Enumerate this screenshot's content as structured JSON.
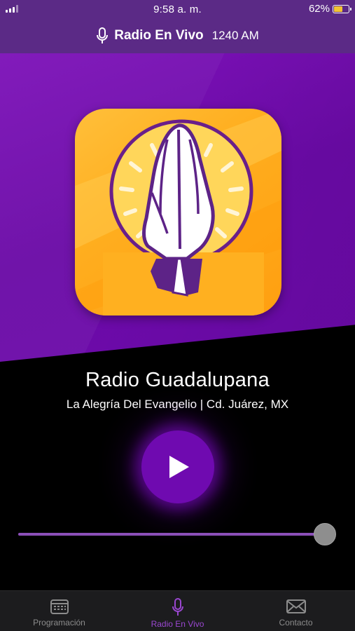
{
  "status_bar": {
    "time": "9:58 a. m.",
    "battery": "62%",
    "battery_level": 0.62
  },
  "header": {
    "title": "Radio En Vivo",
    "frequency": "1240 AM",
    "icon": "microphone-icon"
  },
  "station": {
    "name": "Radio Guadalupana",
    "tagline": "La Alegría Del Evangelio | Cd. Juárez, MX",
    "logo_icon": "praying-hands-icon"
  },
  "player": {
    "play_icon": "play-icon",
    "volume_level": 0.99
  },
  "tabs": [
    {
      "label": "Programación",
      "icon": "calendar-icon",
      "active": false
    },
    {
      "label": "Radio En Vivo",
      "icon": "microphone-icon",
      "active": true
    },
    {
      "label": "Contacto",
      "icon": "envelope-icon",
      "active": false
    }
  ],
  "colors": {
    "header_purple": "#5b2a86",
    "hero_purple": "#6a0aa6",
    "accent_purple": "#9a47d0",
    "logo_orange": "#ffae1f"
  }
}
